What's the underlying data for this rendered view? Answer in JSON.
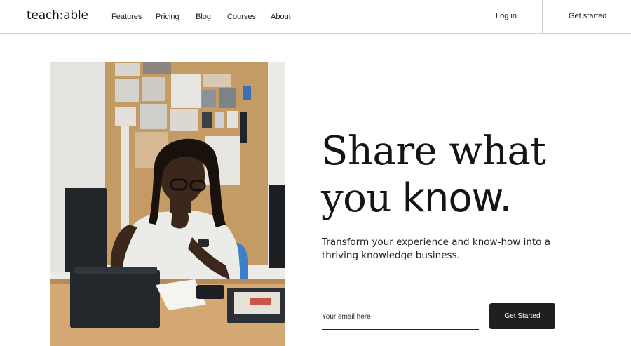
{
  "brand": {
    "logo_text": "teach:able"
  },
  "nav": {
    "links": [
      "Features",
      "Pricing",
      "Blog",
      "Courses",
      "About"
    ],
    "login_label": "Log in",
    "cta_label": "Get started"
  },
  "hero": {
    "headline_line1": "Share what",
    "headline_line2_light": "you",
    "headline_line2_bold": "know.",
    "subtext": "Transform your experience and know-how into a thriving knowledge business.",
    "email_placeholder": "Your email here",
    "cta_label": "Get Started"
  }
}
